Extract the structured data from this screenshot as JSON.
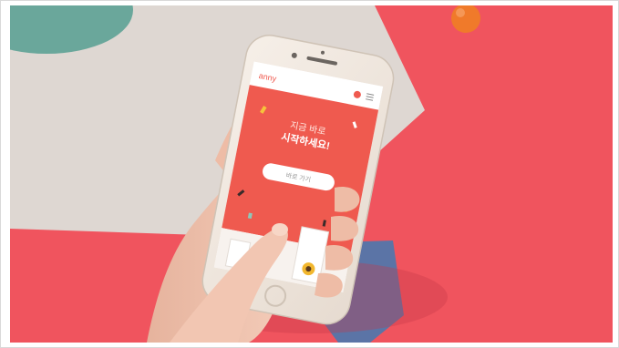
{
  "photo": {
    "description_tag": "hand-holding-smartphone-app-promo",
    "colors": {
      "background_red": "#f0545e",
      "board_beige": "#ded7d2",
      "teal_circle": "#6aa79b",
      "blue_shape": "#5b74a6",
      "app_red": "#ef5a4f",
      "orange_ball": "#f07a2a"
    }
  },
  "app": {
    "logo_text": "anny",
    "headline_line1": "지금 바로",
    "headline_line2": "시작하세요!",
    "cta_button": "바로 가기",
    "header_icons": [
      "heart-badge-icon",
      "menu-icon"
    ]
  }
}
